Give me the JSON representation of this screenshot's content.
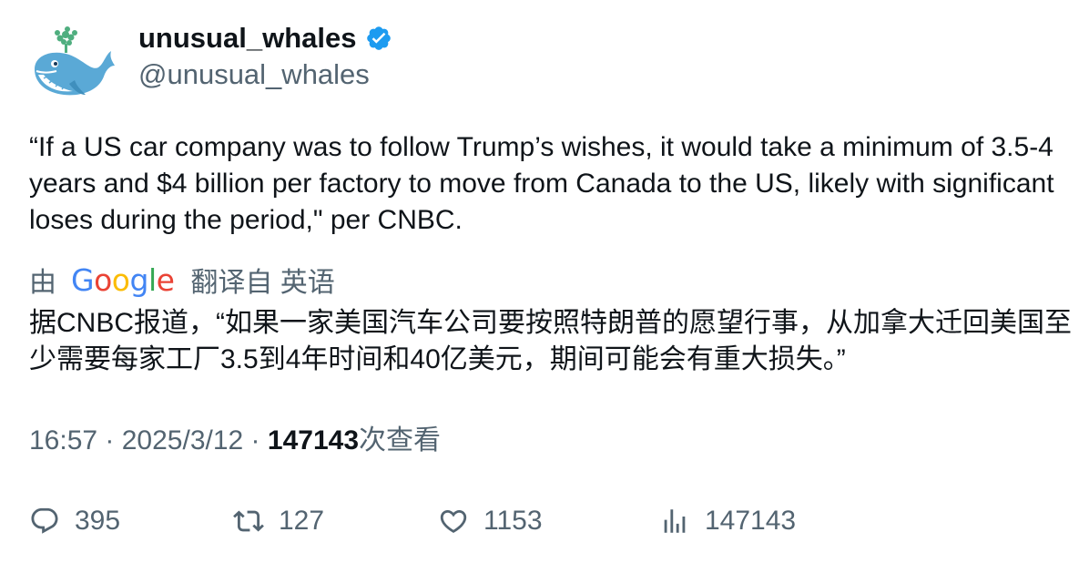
{
  "author": {
    "display_name": "unusual_whales",
    "handle": "@unusual_whales",
    "verified": true,
    "verified_color": "#1d9bf0"
  },
  "tweet": {
    "text": "“If a US car company was to follow Trump’s wishes, it would take a minimum of 3.5-4 years and $4 billion per factory to move from Canada to the US, likely with significant loses during the period,\" per CNBC."
  },
  "translation": {
    "by_label": "由",
    "google_letters": [
      "G",
      "o",
      "o",
      "g",
      "l",
      "e"
    ],
    "from_label": "翻译自 英语",
    "text": "据CNBC报道，“如果一家美国汽车公司要按照特朗普的愿望行事，从加拿大迁回美国至少需要每家工厂3.5到4年时间和40亿美元，期间可能会有重大损失。”"
  },
  "meta": {
    "time": "16:57",
    "separator": " · ",
    "date": "2025/3/12",
    "views_count": "147143",
    "views_label": "次查看"
  },
  "actions": {
    "replies": "395",
    "retweets": "127",
    "likes": "1153",
    "views": "147143"
  },
  "colors": {
    "text_primary": "#0f1419",
    "text_secondary": "#536471",
    "avatar_whale": "#5aa9d6",
    "avatar_spout": "#4fae7f"
  }
}
